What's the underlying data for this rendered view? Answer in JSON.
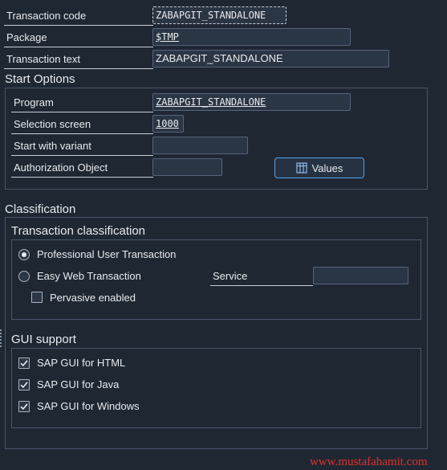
{
  "header_fields": {
    "transaction_code": {
      "label": "Transaction code",
      "value": "ZABAPGIT_STANDALONE"
    },
    "package": {
      "label": "Package",
      "value": "$TMP"
    },
    "transaction_text": {
      "label": "Transaction text",
      "value": "ZABAPGIT_STANDALONE"
    }
  },
  "start_options": {
    "title": "Start Options",
    "program": {
      "label": "Program",
      "value": "ZABAPGIT_STANDALONE"
    },
    "selection_screen": {
      "label": "Selection screen",
      "value": "1000"
    },
    "start_with_variant": {
      "label": "Start with variant",
      "value": ""
    },
    "authorization_object": {
      "label": "Authorization Object",
      "value": ""
    },
    "values_button": "Values"
  },
  "classification": {
    "title": "Classification",
    "transaction_classification": {
      "title": "Transaction classification",
      "professional": {
        "label": "Professional User Transaction",
        "selected": true
      },
      "easy_web": {
        "label": "Easy Web Transaction",
        "selected": false
      },
      "service": {
        "label": "Service",
        "value": ""
      },
      "pervasive": {
        "label": "Pervasive enabled",
        "checked": false
      }
    },
    "gui_support": {
      "title": "GUI support",
      "html": {
        "label": "SAP GUI for HTML",
        "checked": true
      },
      "java": {
        "label": "SAP GUI for Java",
        "checked": true
      },
      "windows": {
        "label": "SAP GUI for Windows",
        "checked": true
      }
    }
  },
  "watermark": "www.mustafahamit.com"
}
